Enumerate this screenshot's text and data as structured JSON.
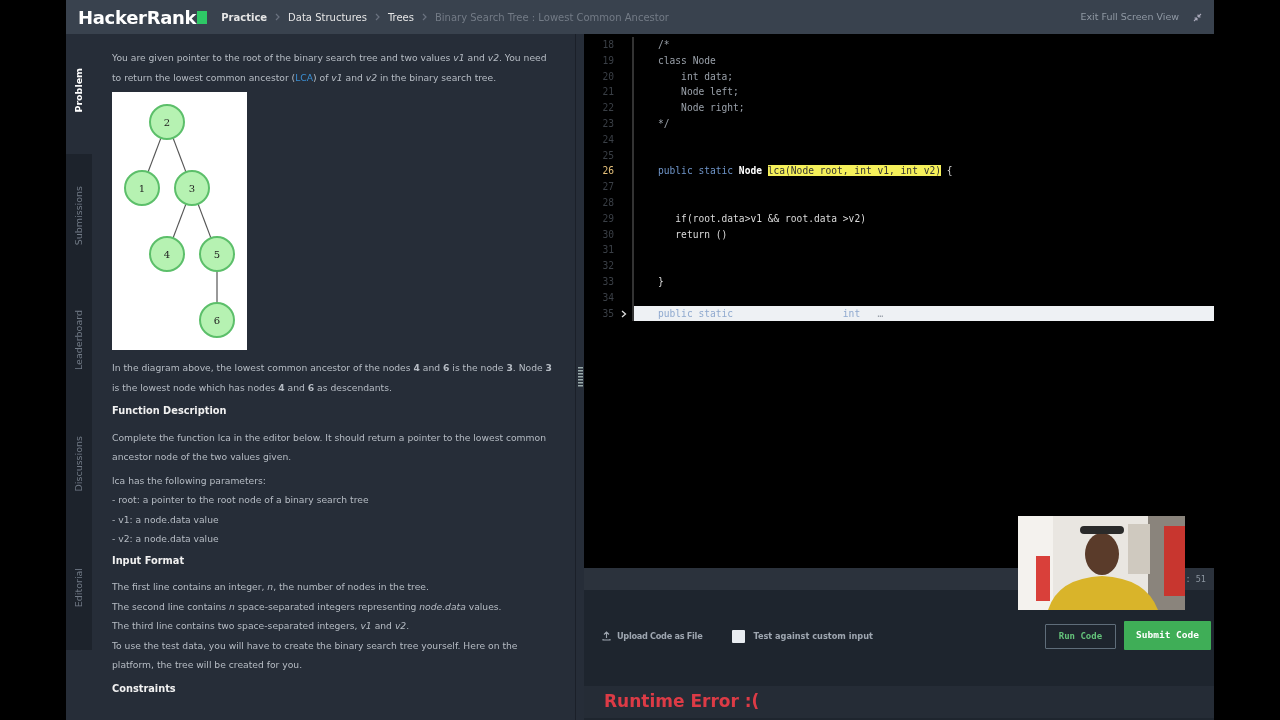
{
  "header": {
    "logo": "HackerRank",
    "breadcrumbs": [
      {
        "label": "Practice",
        "current": false
      },
      {
        "label": "Data Structures",
        "current": false
      },
      {
        "label": "Trees",
        "current": false
      },
      {
        "label": "Binary Search Tree : Lowest Common Ancestor",
        "current": true
      }
    ],
    "exit_label": "Exit Full Screen View"
  },
  "side_tabs": [
    {
      "label": "Problem",
      "selected": true
    },
    {
      "label": "Submissions",
      "selected": false
    },
    {
      "label": "Leaderboard",
      "selected": false
    },
    {
      "label": "Discussions",
      "selected": false
    },
    {
      "label": "Editorial",
      "selected": false
    }
  ],
  "problem": {
    "intro": "You are given pointer to the root of the binary search tree and two values *v1* and *v2*. You need to return the lowest common ancestor (",
    "intro_link": "LCA",
    "intro_end": ") of *v1* and *v2* in the binary search tree.",
    "tree": {
      "label": "2",
      "children": [
        {
          "label": "1"
        },
        {
          "label": "3",
          "children": [
            {
              "label": "4"
            },
            {
              "label": "5",
              "children": [
                {
                  "label": "6"
                }
              ]
            }
          ]
        }
      ]
    },
    "blocks": [
      {
        "kind": "paragraph",
        "text": "In the diagram above, the lowest common ancestor of the nodes **4** and **6** is the node **3**. Node **3** is the lowest node which has nodes **4** and **6** as descendants."
      },
      {
        "kind": "heading",
        "text": "Function Description"
      },
      {
        "kind": "paragraph",
        "text": "Complete the function lca in the editor below. It should return a pointer to the lowest common ancestor node of the two values given."
      },
      {
        "kind": "line",
        "text": "lca has the following parameters:"
      },
      {
        "kind": "line",
        "text": "- root: a pointer to the root node of a binary search tree"
      },
      {
        "kind": "line",
        "text": "- v1: a node.data value"
      },
      {
        "kind": "line",
        "text": "- v2: a node.data value"
      },
      {
        "kind": "heading",
        "text": "Input Format"
      },
      {
        "kind": "line",
        "text": "The first line contains an integer, *n*, the number of nodes in the tree."
      },
      {
        "kind": "line",
        "text": "The second line contains *n* space-separated integers representing *node.data* values."
      },
      {
        "kind": "line",
        "text": "The third line contains two space-separated integers, *v1* and *v2*."
      },
      {
        "kind": "paragraph",
        "text": "To use the test data, you will have to create the binary search tree yourself. Here on the platform, the tree will be created for you."
      },
      {
        "kind": "heading",
        "text": "Constraints"
      }
    ]
  },
  "editor": {
    "lines": [
      {
        "num": "18",
        "current": false,
        "folded": false,
        "segments": [
          {
            "kind": "comment",
            "text": "/*"
          }
        ]
      },
      {
        "num": "19",
        "current": false,
        "folded": false,
        "segments": [
          {
            "kind": "comment",
            "text": "class Node"
          }
        ]
      },
      {
        "num": "20",
        "current": false,
        "folded": false,
        "segments": [
          {
            "kind": "comment",
            "text": "    int data;"
          }
        ]
      },
      {
        "num": "21",
        "current": false,
        "folded": false,
        "segments": [
          {
            "kind": "comment",
            "text": "    Node left;"
          }
        ]
      },
      {
        "num": "22",
        "current": false,
        "folded": false,
        "segments": [
          {
            "kind": "comment",
            "text": "    Node right;"
          }
        ]
      },
      {
        "num": "23",
        "current": false,
        "folded": false,
        "segments": [
          {
            "kind": "comment",
            "text": "*/"
          }
        ]
      },
      {
        "num": "24",
        "current": false,
        "folded": false
      },
      {
        "num": "25",
        "current": false,
        "folded": false
      },
      {
        "num": "26",
        "current": true,
        "folded": false,
        "segments": [
          {
            "kind": "keyword",
            "text": "public static"
          },
          {
            "kind": "type",
            "text": "Node"
          },
          {
            "kind": "highlight",
            "text": "lca(Node root, int v1, int v2)"
          },
          {
            "kind": "plain",
            "text": "{"
          }
        ]
      },
      {
        "num": "27",
        "current": false,
        "folded": false
      },
      {
        "num": "28",
        "current": false,
        "folded": false
      },
      {
        "num": "29",
        "current": false,
        "folded": false,
        "segments": [
          {
            "kind": "plain",
            "text": "   if(root.data>v1 && root.data >v2)"
          }
        ]
      },
      {
        "num": "30",
        "current": false,
        "folded": false,
        "segments": [
          {
            "kind": "plain",
            "text": "   return ()"
          }
        ]
      },
      {
        "num": "31",
        "current": false,
        "folded": false
      },
      {
        "num": "32",
        "current": false,
        "folded": false
      },
      {
        "num": "33",
        "current": false,
        "folded": false,
        "segments": [
          {
            "kind": "plain",
            "text": "}"
          }
        ]
      },
      {
        "num": "34",
        "current": false,
        "folded": false
      },
      {
        "num": "35",
        "current": false,
        "folded": true,
        "segments": [
          {
            "kind": "keyword",
            "text": "public static"
          },
          {
            "kind": "keyword",
            "text": "int"
          },
          {
            "kind": "comment",
            "text": "…"
          }
        ]
      }
    ],
    "status": ": 51"
  },
  "actions": {
    "upload": "Upload Code as File",
    "custom_input": {
      "label": "Test against custom input",
      "checked": false
    },
    "run": "Run Code",
    "submit": "Submit Code"
  },
  "result": {
    "kind": "error",
    "text": "Runtime Error :("
  }
}
